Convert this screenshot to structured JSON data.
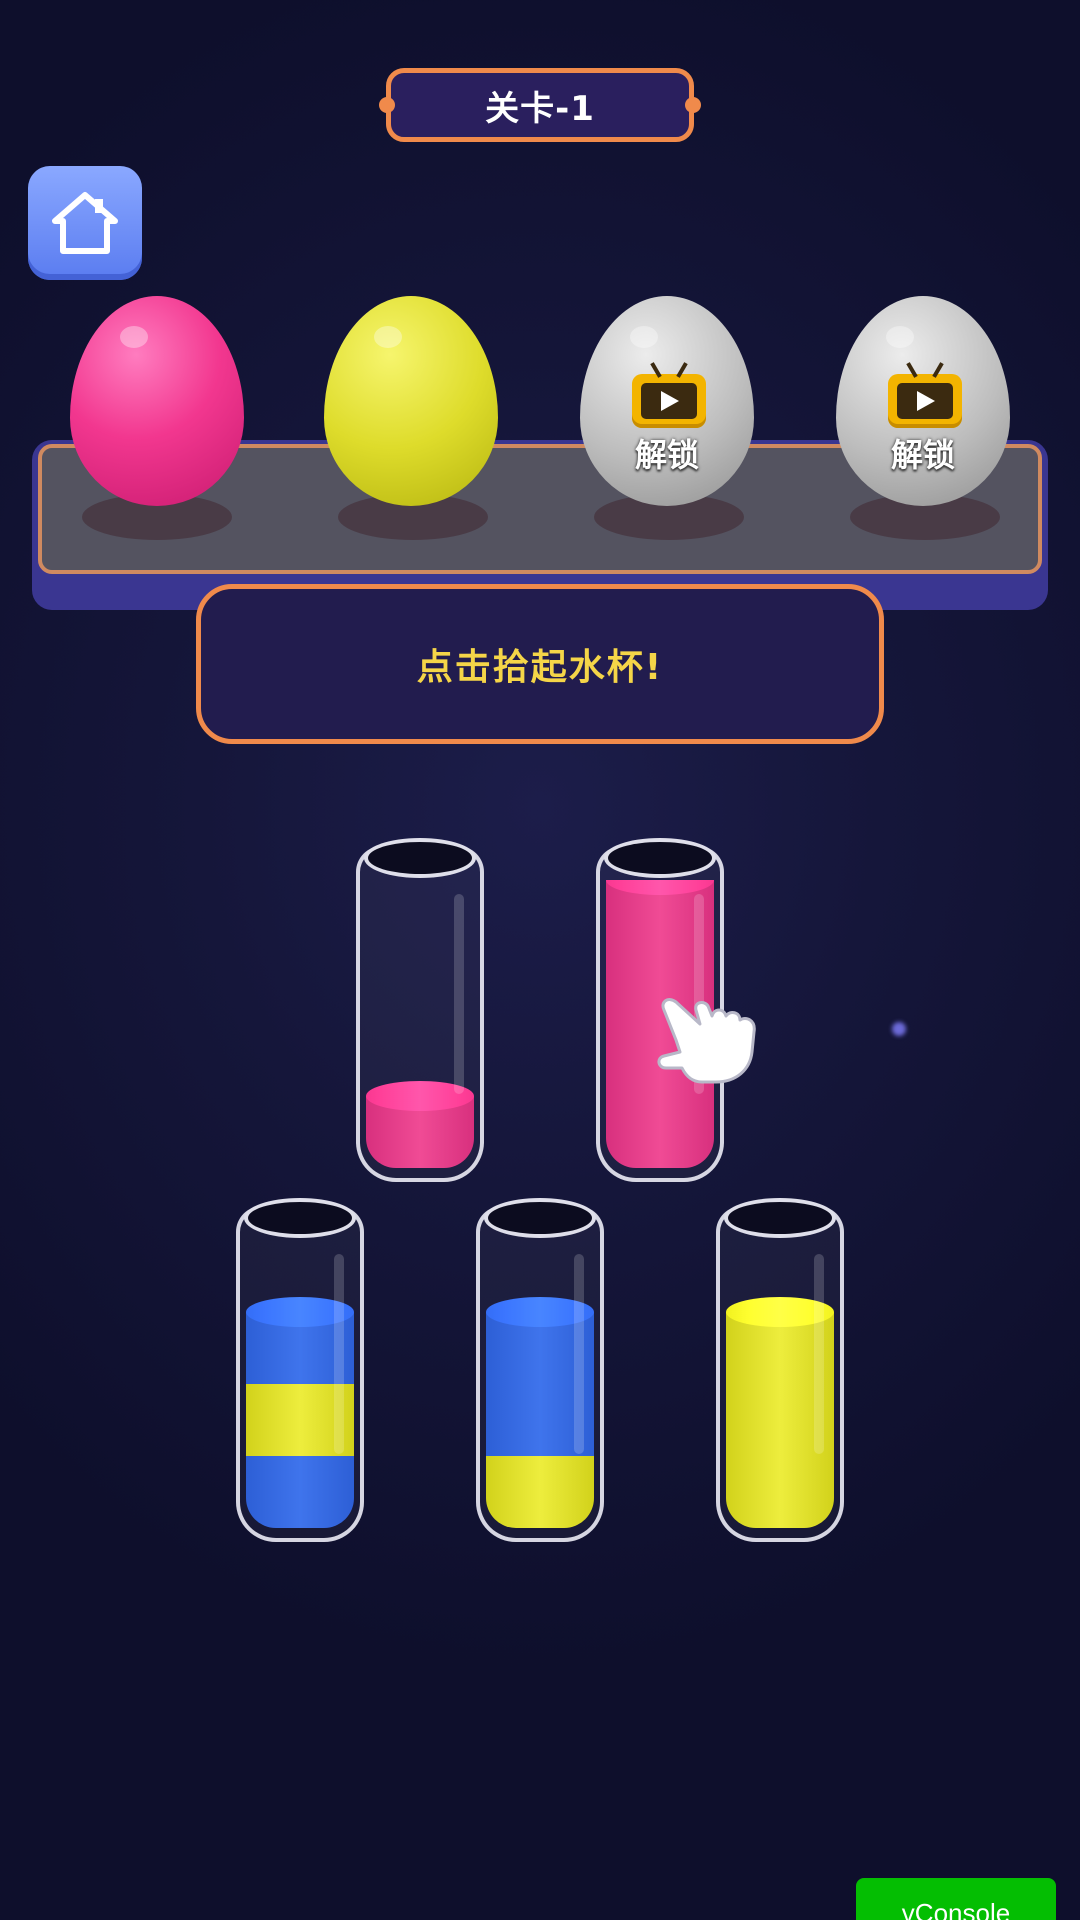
{
  "level": {
    "title": "关卡-1"
  },
  "home": {
    "icon": "home-icon"
  },
  "eggs": [
    {
      "color": "pink",
      "locked": false
    },
    {
      "color": "yellow",
      "locked": false
    },
    {
      "color": "gray",
      "locked": true,
      "label": "解锁",
      "icon": "video-tv-icon"
    },
    {
      "color": "gray",
      "locked": true,
      "label": "解锁",
      "icon": "video-tv-icon"
    }
  ],
  "hint": {
    "text": "点击拾起水杯!"
  },
  "tubes": [
    {
      "layers": [
        "pink"
      ]
    },
    {
      "layers": [
        "pink",
        "pink",
        "pink",
        "pink"
      ]
    },
    {
      "layers": [
        "blue",
        "yellow",
        "blue"
      ]
    },
    {
      "layers": [
        "yellow",
        "blue",
        "blue"
      ]
    },
    {
      "layers": [
        "yellow",
        "yellow",
        "yellow"
      ]
    }
  ],
  "colors": {
    "pink": "#f04b95",
    "blue": "#3f74ec",
    "yellow": "#eded3d",
    "accent_border": "#f08a4b",
    "hint_text": "#f5d548"
  },
  "pointer": {
    "icon": "pointing-hand-icon"
  },
  "debug": {
    "vconsole_label": "vConsole"
  }
}
